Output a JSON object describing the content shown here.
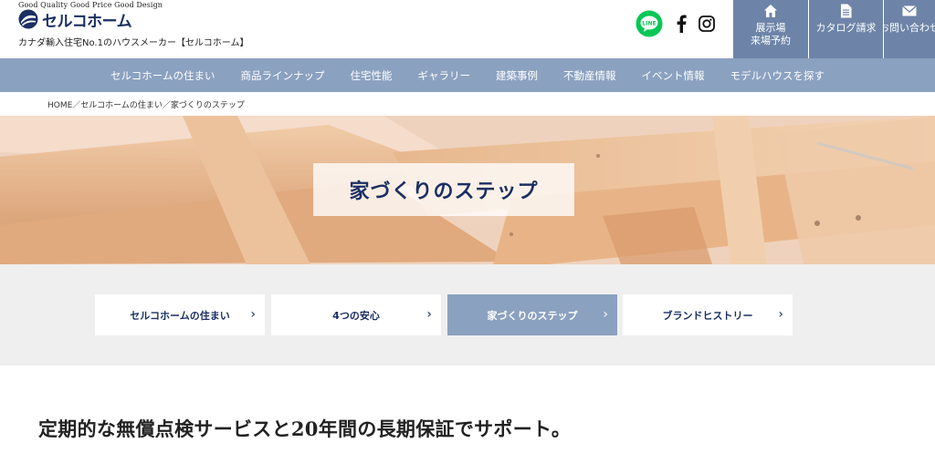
{
  "header": {
    "tagline": "Good Quality  Good Price  Good Design",
    "logo_text": "セルコホーム",
    "subtitle": "カナダ輸入住宅No.1のハウスメーカー【セルコホーム】",
    "social": [
      "line-icon",
      "facebook-icon",
      "instagram-icon"
    ],
    "line_label": "LINE",
    "buttons": [
      {
        "label": "展示場\n来場予約",
        "icon": "home-icon"
      },
      {
        "label": "カタログ請求",
        "icon": "document-icon"
      },
      {
        "label": "お問い合わせ",
        "icon": "mail-icon"
      }
    ]
  },
  "nav": {
    "items": [
      "セルコホームの住まい",
      "商品ラインナップ",
      "住宅性能",
      "ギャラリー",
      "建築事例",
      "不動産情報",
      "イベント情報",
      "モデルハウスを探す"
    ]
  },
  "breadcrumb": "HOME／セルコホームの住まい／家づくりのステップ",
  "hero": {
    "title": "家づくりのステップ"
  },
  "tabs": [
    {
      "label": "セルコホームの住まい",
      "active": false
    },
    {
      "label": "4つの安心",
      "active": false
    },
    {
      "label": "家づくりのステップ",
      "active": true
    },
    {
      "label": "ブランドヒストリー",
      "active": false
    }
  ],
  "main": {
    "lead": "定期的な無償点検サービスと20年間の長期保証でサポート。"
  },
  "colors": {
    "brand_navy": "#1b2f63",
    "header_button": "#6d84a8",
    "nav_bar": "#8ba1c0",
    "line_green": "#06c755",
    "tab_bg": "#efefef"
  }
}
